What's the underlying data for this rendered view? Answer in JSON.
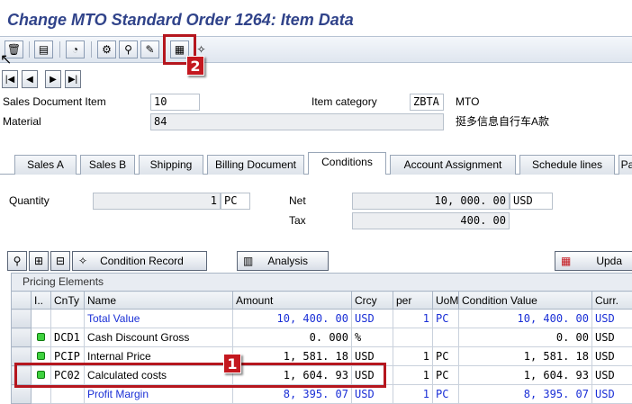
{
  "window": {
    "title": "Change MTO Standard Order 1264: Item Data"
  },
  "toolbar": {
    "icons": [
      "delete-icon",
      "document-icon",
      "display-changes-icon",
      "configuration-icon",
      "search-icon",
      "edit-icon",
      "calculator-icon",
      "condition-record-icon"
    ]
  },
  "header": {
    "sales_doc_item_label": "Sales Document Item",
    "sales_doc_item_value": "10",
    "item_category_label": "Item category",
    "item_category_value": "ZBTA",
    "item_category_text": "MTO",
    "material_label": "Material",
    "material_value": "84",
    "material_text": "挺多信息自行车A款"
  },
  "tabs": [
    {
      "label": "Sales A"
    },
    {
      "label": "Sales B"
    },
    {
      "label": "Shipping"
    },
    {
      "label": "Billing Document"
    },
    {
      "label": "Conditions",
      "active": true
    },
    {
      "label": "Account Assignment"
    },
    {
      "label": "Schedule lines"
    },
    {
      "label": "Pa"
    }
  ],
  "conditions": {
    "quantity_label": "Quantity",
    "quantity_value": "1",
    "quantity_unit": "PC",
    "net_label": "Net",
    "net_value": "10, 000. 00",
    "net_currency": "USD",
    "tax_label": "Tax",
    "tax_value": "400. 00"
  },
  "buttons": {
    "condition_record": "Condition Record",
    "analysis": "Analysis",
    "update": "Upda"
  },
  "pricing": {
    "caption": "Pricing Elements",
    "columns": [
      "I..",
      "CnTy",
      "Name",
      "Amount",
      "Crcy",
      "per",
      "UoM",
      "Condition Value",
      "Curr."
    ],
    "rows": [
      {
        "status": "",
        "cnty": "",
        "name": "Total Value",
        "amount": "10, 400. 00",
        "crcy": "USD",
        "per": "1",
        "uom": "PC",
        "cond_value": "10, 400. 00",
        "curr": "USD",
        "blue": true
      },
      {
        "status": "green",
        "cnty": "DCD1",
        "name": "Cash Discount Gross",
        "amount": "0. 000",
        "crcy": "%",
        "per": "",
        "uom": "",
        "cond_value": "0. 00",
        "curr": "USD",
        "blue": false
      },
      {
        "status": "green",
        "cnty": "PCIP",
        "name": "Internal Price",
        "amount": "1, 581. 18",
        "crcy": "USD",
        "per": "1",
        "uom": "PC",
        "cond_value": "1, 581. 18",
        "curr": "USD",
        "blue": false
      },
      {
        "status": "green",
        "cnty": "PC02",
        "name": "Calculated costs",
        "amount": "1, 604. 93",
        "crcy": "USD",
        "per": "1",
        "uom": "PC",
        "cond_value": "1, 604. 93",
        "curr": "USD",
        "blue": false
      },
      {
        "status": "",
        "cnty": "",
        "name": "Profit Margin",
        "amount": "8, 395. 07",
        "crcy": "USD",
        "per": "1",
        "uom": "PC",
        "cond_value": "8, 395. 07",
        "curr": "USD",
        "blue": true
      }
    ]
  },
  "annotations": {
    "badge_1": "1",
    "badge_2": "2",
    "color": "#c4181f"
  }
}
